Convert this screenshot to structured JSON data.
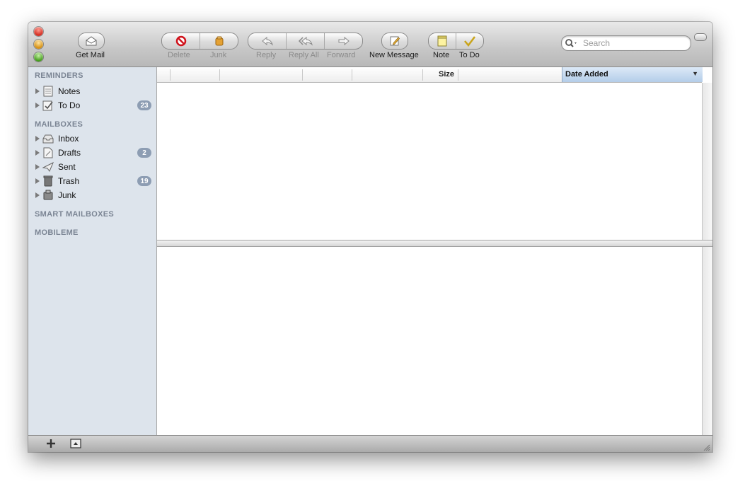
{
  "toolbar": {
    "get_mail": "Get Mail",
    "delete": "Delete",
    "junk": "Junk",
    "reply": "Reply",
    "reply_all": "Reply All",
    "forward": "Forward",
    "new_message": "New Message",
    "note": "Note",
    "todo": "To Do",
    "search_placeholder": "Search"
  },
  "sidebar": {
    "reminders_header": "REMINDERS",
    "reminders": [
      {
        "label": "Notes",
        "badge": ""
      },
      {
        "label": "To Do",
        "badge": "23"
      }
    ],
    "mailboxes_header": "MAILBOXES",
    "mailboxes": [
      {
        "label": "Inbox",
        "badge": ""
      },
      {
        "label": "Drafts",
        "badge": "2"
      },
      {
        "label": "Sent",
        "badge": ""
      },
      {
        "label": "Trash",
        "badge": "19"
      },
      {
        "label": "Junk",
        "badge": ""
      }
    ],
    "smart_header": "SMART MAILBOXES",
    "mobileme_header": "MOBILEME"
  },
  "message_list": {
    "columns": [
      "Size",
      "Date Added"
    ],
    "sort_indicator": "▼"
  },
  "colors": {
    "sidebar_bg": "#dde4ec",
    "badge": "#8d9db3",
    "sorted_column": "#b4cde9"
  },
  "icons": {
    "get_mail": "envelope-icon",
    "delete": "no-entry-icon",
    "junk": "junk-bag-icon",
    "reply": "reply-arrow-icon",
    "reply_all": "reply-all-arrow-icon",
    "forward": "forward-arrow-icon",
    "new_message": "compose-icon",
    "note": "note-icon",
    "todo": "checkmark-icon"
  }
}
